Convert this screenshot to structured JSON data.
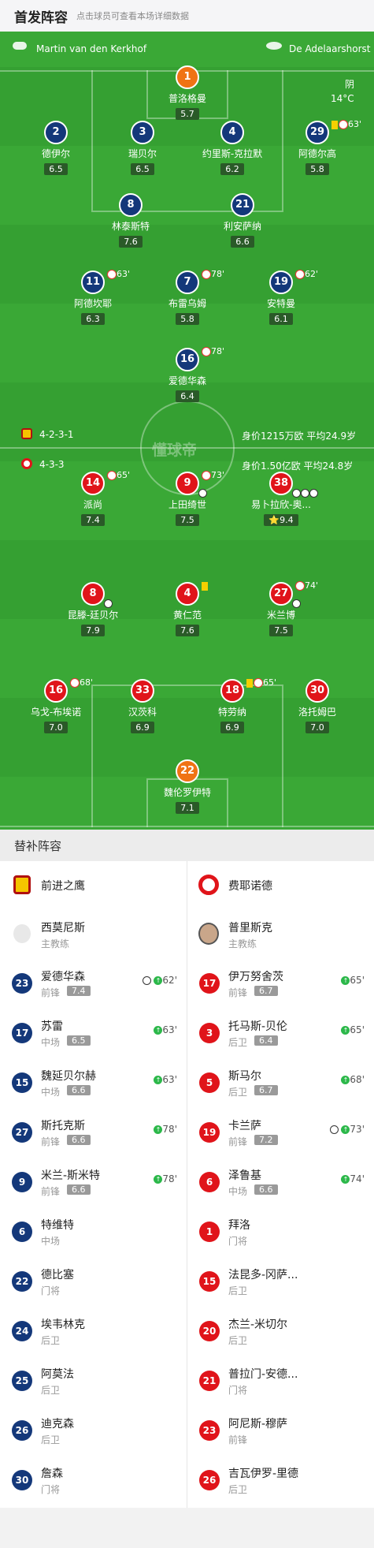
{
  "header": {
    "title": "首发阵容",
    "subtitle": "点击球员可查看本场详细数据"
  },
  "pitch": {
    "referee": "Martin van den Kerkhof",
    "stadium": "De Adelaarshorst",
    "weather": "阴",
    "temp": "14°C",
    "watermark": "懂球帝",
    "home_formation": "4-2-3-1",
    "home_value": "身价1215万欧 平均24.9岁",
    "away_formation": "4-3-3",
    "away_value": "身价1.50亿欧 平均24.8岁"
  },
  "players": [
    {
      "num": "1",
      "name": "普洛格曼",
      "rating": "5.7",
      "color": "gk",
      "ev": ""
    },
    {
      "num": "2",
      "name": "德伊尔",
      "rating": "6.5",
      "color": "blue",
      "ev": "",
      "captain": true
    },
    {
      "num": "3",
      "name": "瑞贝尔",
      "rating": "6.5",
      "color": "blue",
      "ev": ""
    },
    {
      "num": "4",
      "name": "约里斯-克拉默",
      "rating": "6.2",
      "color": "blue",
      "ev": ""
    },
    {
      "num": "29",
      "name": "阿德尔高",
      "rating": "5.8",
      "color": "blue",
      "ev": "63'",
      "ycard": true,
      "subbed": true
    },
    {
      "num": "8",
      "name": "林泰斯特",
      "rating": "7.6",
      "color": "blue",
      "ev": ""
    },
    {
      "num": "21",
      "name": "利安萨纳",
      "rating": "6.6",
      "color": "blue",
      "ev": ""
    },
    {
      "num": "11",
      "name": "阿德坎耶",
      "rating": "6.3",
      "color": "blue",
      "ev": "63'",
      "subbed": true
    },
    {
      "num": "7",
      "name": "布雷乌姆",
      "rating": "5.8",
      "color": "blue",
      "ev": "78'",
      "subbed": true
    },
    {
      "num": "19",
      "name": "安特曼",
      "rating": "6.1",
      "color": "blue",
      "ev": "62'",
      "subbed": true
    },
    {
      "num": "16",
      "name": "爱德华森",
      "rating": "6.4",
      "color": "blue",
      "ev": "78'",
      "subbed": true
    },
    {
      "num": "14",
      "name": "派尚",
      "rating": "7.4",
      "color": "red",
      "ev": "65'",
      "subbed": true
    },
    {
      "num": "9",
      "name": "上田绮世",
      "rating": "7.5",
      "color": "red",
      "ev": "73'",
      "subbed": true,
      "goal": true
    },
    {
      "num": "38",
      "name": "易卜拉欣-奥...",
      "rating": "⭐9.4",
      "color": "red",
      "ev": "",
      "goals": 3
    },
    {
      "num": "8",
      "name": "昆滕-廷贝尔",
      "rating": "7.9",
      "color": "red",
      "ev": "",
      "captain": true,
      "goal": true
    },
    {
      "num": "4",
      "name": "黄仁范",
      "rating": "7.6",
      "color": "red",
      "ev": "",
      "ycard": true
    },
    {
      "num": "27",
      "name": "米兰博",
      "rating": "7.5",
      "color": "red",
      "ev": "74'",
      "subbed": true,
      "goal": true
    },
    {
      "num": "16",
      "name": "乌戈-布埃诺",
      "rating": "7.0",
      "color": "red",
      "ev": "68'",
      "subbed": true
    },
    {
      "num": "33",
      "name": "汉茨科",
      "rating": "6.9",
      "color": "red",
      "ev": ""
    },
    {
      "num": "18",
      "name": "特劳纳",
      "rating": "6.9",
      "color": "red",
      "ev": "65'",
      "ycard": true,
      "subbed": true
    },
    {
      "num": "30",
      "name": "洛托姆巴",
      "rating": "7.0",
      "color": "red",
      "ev": ""
    },
    {
      "num": "22",
      "name": "魏伦罗伊特",
      "rating": "7.1",
      "color": "gk",
      "ev": ""
    }
  ],
  "subs": {
    "title": "替补阵容",
    "home_team": "前进之鹰",
    "away_team": "费耶诺德",
    "home_coach": "西莫尼斯",
    "away_coach": "普里斯克",
    "coach_label": "主教练",
    "home": [
      {
        "num": "23",
        "name": "爱德华森",
        "pos": "前锋",
        "rating": "7.4",
        "sub": "62'",
        "goal": true
      },
      {
        "num": "17",
        "name": "苏雷",
        "pos": "中场",
        "rating": "6.5",
        "sub": "63'"
      },
      {
        "num": "15",
        "name": "魏延贝尔赫",
        "pos": "中场",
        "rating": "6.6",
        "sub": "63'"
      },
      {
        "num": "27",
        "name": "斯托克斯",
        "pos": "前锋",
        "rating": "6.6",
        "sub": "78'"
      },
      {
        "num": "9",
        "name": "米兰-斯米特",
        "pos": "前锋",
        "rating": "6.6",
        "sub": "78'"
      },
      {
        "num": "6",
        "name": "特维特",
        "pos": "中场",
        "rating": "",
        "sub": ""
      },
      {
        "num": "22",
        "name": "德比塞",
        "pos": "门将",
        "rating": "",
        "sub": ""
      },
      {
        "num": "24",
        "name": "埃韦林克",
        "pos": "后卫",
        "rating": "",
        "sub": ""
      },
      {
        "num": "25",
        "name": "阿莫法",
        "pos": "后卫",
        "rating": "",
        "sub": ""
      },
      {
        "num": "26",
        "name": "迪克森",
        "pos": "后卫",
        "rating": "",
        "sub": ""
      },
      {
        "num": "30",
        "name": "詹森",
        "pos": "门将",
        "rating": "",
        "sub": ""
      }
    ],
    "away": [
      {
        "num": "17",
        "name": "伊万努舍茨",
        "pos": "前锋",
        "rating": "6.7",
        "sub": "65'"
      },
      {
        "num": "3",
        "name": "托马斯-贝伦",
        "pos": "后卫",
        "rating": "6.4",
        "sub": "65'"
      },
      {
        "num": "5",
        "name": "斯马尔",
        "pos": "后卫",
        "rating": "6.7",
        "sub": "68'"
      },
      {
        "num": "19",
        "name": "卡兰萨",
        "pos": "前锋",
        "rating": "7.2",
        "sub": "73'",
        "goal": true
      },
      {
        "num": "6",
        "name": "泽鲁基",
        "pos": "中场",
        "rating": "6.6",
        "sub": "74'"
      },
      {
        "num": "1",
        "name": "拜洛",
        "pos": "门将",
        "rating": "",
        "sub": ""
      },
      {
        "num": "15",
        "name": "法昆多-冈萨...",
        "pos": "后卫",
        "rating": "",
        "sub": ""
      },
      {
        "num": "20",
        "name": "杰兰-米切尔",
        "pos": "后卫",
        "rating": "",
        "sub": ""
      },
      {
        "num": "21",
        "name": "普拉门-安德...",
        "pos": "门将",
        "rating": "",
        "sub": ""
      },
      {
        "num": "23",
        "name": "阿尼斯-穆萨",
        "pos": "前锋",
        "rating": "",
        "sub": ""
      },
      {
        "num": "26",
        "name": "吉瓦伊罗-里德",
        "pos": "后卫",
        "rating": "",
        "sub": ""
      }
    ]
  }
}
